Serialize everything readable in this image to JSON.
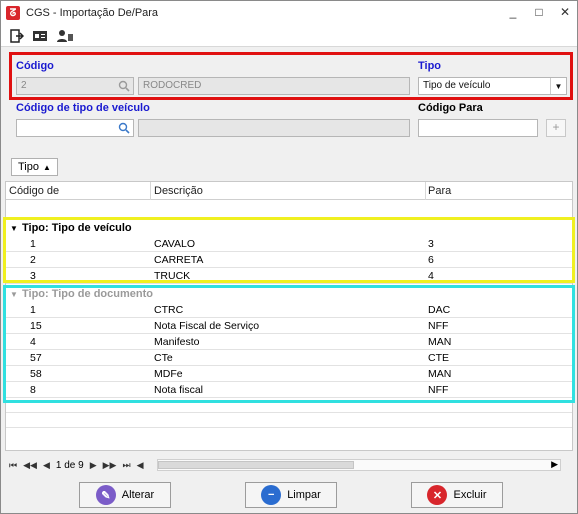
{
  "window": {
    "title": "CGS - Importação De/Para",
    "icon": "app-logo-icon"
  },
  "titlebar": {
    "minimize": "_",
    "maximize": "□",
    "close": "✕"
  },
  "toolbar": {
    "icons": [
      "exit-icon",
      "card-icon",
      "user-icon"
    ]
  },
  "form": {
    "codigo_label": "Código",
    "codigo_value": "2",
    "descricao_value": "RODOCRED",
    "tipo_label": "Tipo",
    "tipo_value": "Tipo de veículo",
    "codigo_tipo_veiculo_label": "Código de tipo de veículo",
    "codigo_tipo_veiculo_value": "",
    "descricao_tipo_value": "",
    "codigo_para_label": "Código Para",
    "codigo_para_value": "",
    "add_label": "+"
  },
  "group_chip": {
    "label": "Tipo"
  },
  "grid": {
    "columns": [
      "Código de",
      "Descrição",
      "Para"
    ],
    "groups": [
      {
        "title": "Tipo: Tipo de veículo",
        "rows": [
          [
            "1",
            "CAVALO",
            "3"
          ],
          [
            "2",
            "CARRETA",
            "6"
          ],
          [
            "3",
            "TRUCK",
            "4"
          ]
        ]
      },
      {
        "title": "Tipo: Tipo de documento",
        "rows": [
          [
            "1",
            "CTRC",
            "DAC"
          ],
          [
            "15",
            "Nota Fiscal de Serviço",
            "NFF"
          ],
          [
            "4",
            "Manifesto",
            "MAN"
          ],
          [
            "57",
            "CTe",
            "CTE"
          ],
          [
            "58",
            "MDFe",
            "MAN"
          ],
          [
            "8",
            "Nota fiscal",
            "NFF"
          ]
        ]
      }
    ]
  },
  "pager": {
    "text": "1 de 9"
  },
  "buttons": {
    "alterar": "Alterar",
    "limpar": "Limpar",
    "excluir": "Excluir"
  },
  "colors": {
    "highlight_red": "#e01010",
    "highlight_yellow": "#f0f020",
    "highlight_cyan": "#30e0e0",
    "label_blue": "#1a1ad0"
  }
}
